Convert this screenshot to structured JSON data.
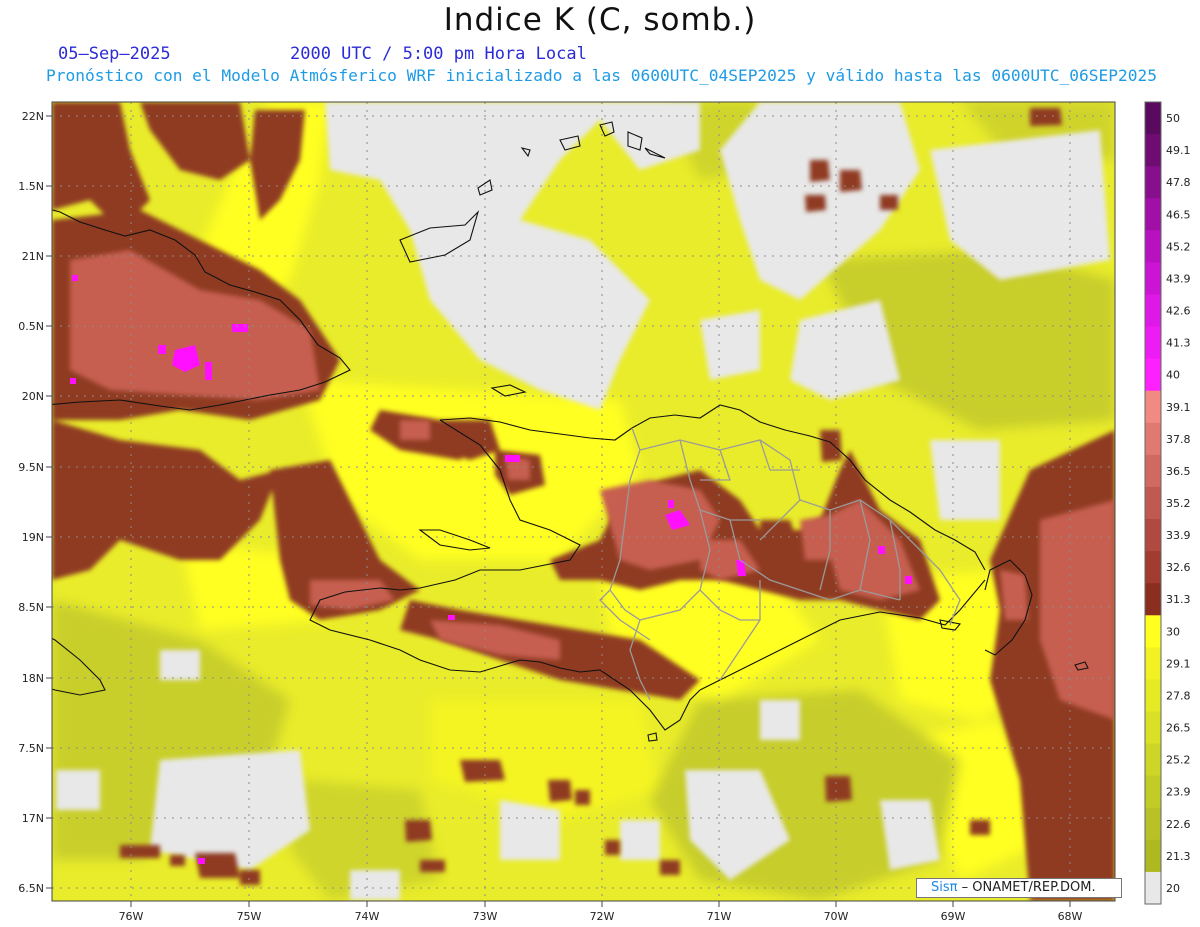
{
  "header": {
    "title": "Indice K (C, somb.)",
    "date": "05–Sep–2025",
    "time": "2000 UTC / 5:00 pm Hora Local",
    "forecast": "Pronóstico con el Modelo Atmósferico WRF inicializado a las 0600UTC_04SEP2025 y válido hasta las  0600UTC_06SEP2025"
  },
  "axes": {
    "lat_labels": [
      "22N",
      "1.5N",
      "21N",
      "0.5N",
      "20N",
      "9.5N",
      "19N",
      "8.5N",
      "18N",
      "7.5N",
      "17N",
      "6.5N"
    ],
    "lon_labels": [
      "76W",
      "75W",
      "74W",
      "73W",
      "72W",
      "71W",
      "70W",
      "69W",
      "68W"
    ]
  },
  "colorbar": {
    "labels": [
      "50",
      "49.1",
      "47.8",
      "46.5",
      "45.2",
      "43.9",
      "42.6",
      "41.3",
      "40",
      "39.1",
      "37.8",
      "36.5",
      "35.2",
      "33.9",
      "32.6",
      "31.3",
      "30",
      "29.1",
      "27.8",
      "26.5",
      "25.2",
      "23.9",
      "22.6",
      "21.3",
      "20"
    ],
    "colors": [
      "#5a0a5e",
      "#6e0c72",
      "#870e8c",
      "#a010a6",
      "#b812c0",
      "#cc14d4",
      "#de18e6",
      "#ee1cf4",
      "#ff20ff",
      "#f08a82",
      "#e07a70",
      "#d06a60",
      "#c05a50",
      "#b04a40",
      "#a03c30",
      "#8a2e20",
      "#ffff20",
      "#f2f222",
      "#e6ea24",
      "#dae026",
      "#cdd626",
      "#c2cc26",
      "#b8c226",
      "#aeb820",
      "#e8e8e8"
    ]
  },
  "credit": {
    "logo": "Sisπ",
    "text": "– ONAMET/REP.DOM."
  }
}
